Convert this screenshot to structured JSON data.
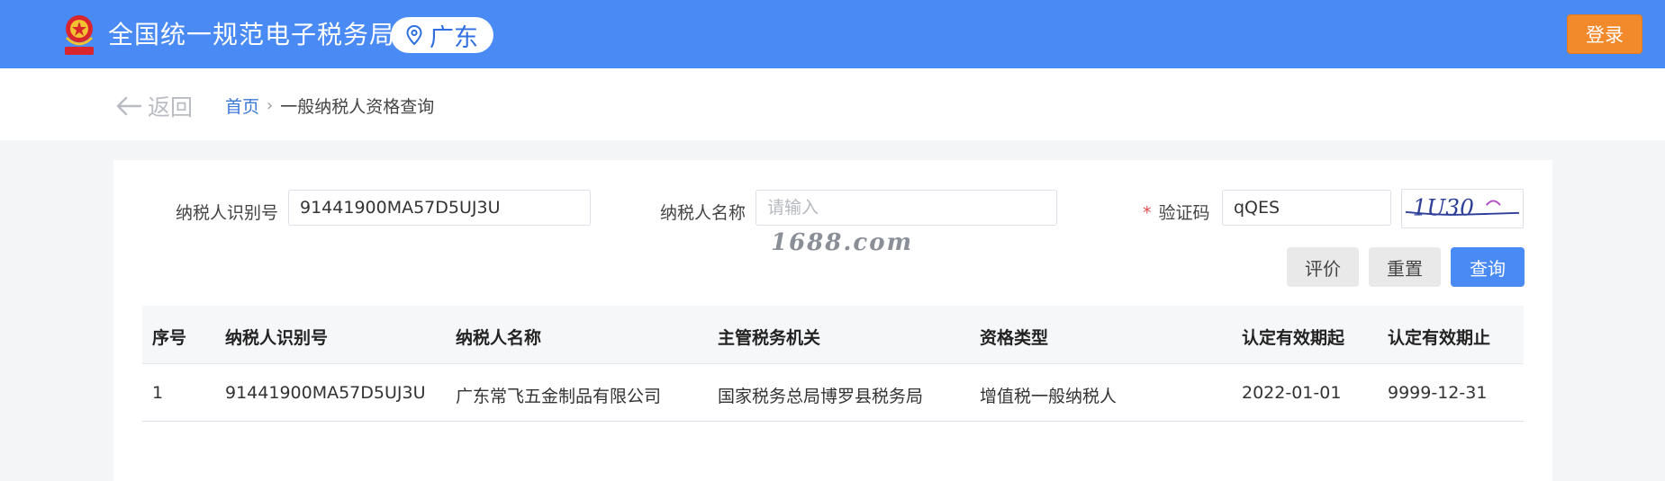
{
  "header": {
    "site_title": "全国统一规范电子税务局",
    "region": "广东",
    "login_label": "登录",
    "emblem_text": "中国税务",
    "accent": "#4a8af4",
    "login_color": "#f28a2c"
  },
  "crumbbar": {
    "back_label": "返回",
    "home": "首页",
    "separator": "›",
    "current": "一般纳税人资格查询"
  },
  "form": {
    "taxpayer_id_label": "纳税人识别号",
    "taxpayer_id_value": "91441900MA57D5UJ3U",
    "taxpayer_name_label": "纳税人名称",
    "taxpayer_name_placeholder": "请输入",
    "captcha_required_mark": "*",
    "captcha_label": "验证码",
    "captcha_value": "qQES",
    "captcha_image_text": "1U30"
  },
  "watermark": "1688.com",
  "buttons": {
    "evaluate": "评价",
    "reset": "重置",
    "query": "查询"
  },
  "table": {
    "columns": [
      "序号",
      "纳税人识别号",
      "纳税人名称",
      "主管税务机关",
      "资格类型",
      "认定有效期起",
      "认定有效期止"
    ],
    "rows": [
      [
        "1",
        "91441900MA57D5UJ3U",
        "广东常飞五金制品有限公司",
        "国家税务总局博罗县税务局",
        "增值税一般纳税人",
        "2022-01-01",
        "9999-12-31"
      ]
    ]
  }
}
